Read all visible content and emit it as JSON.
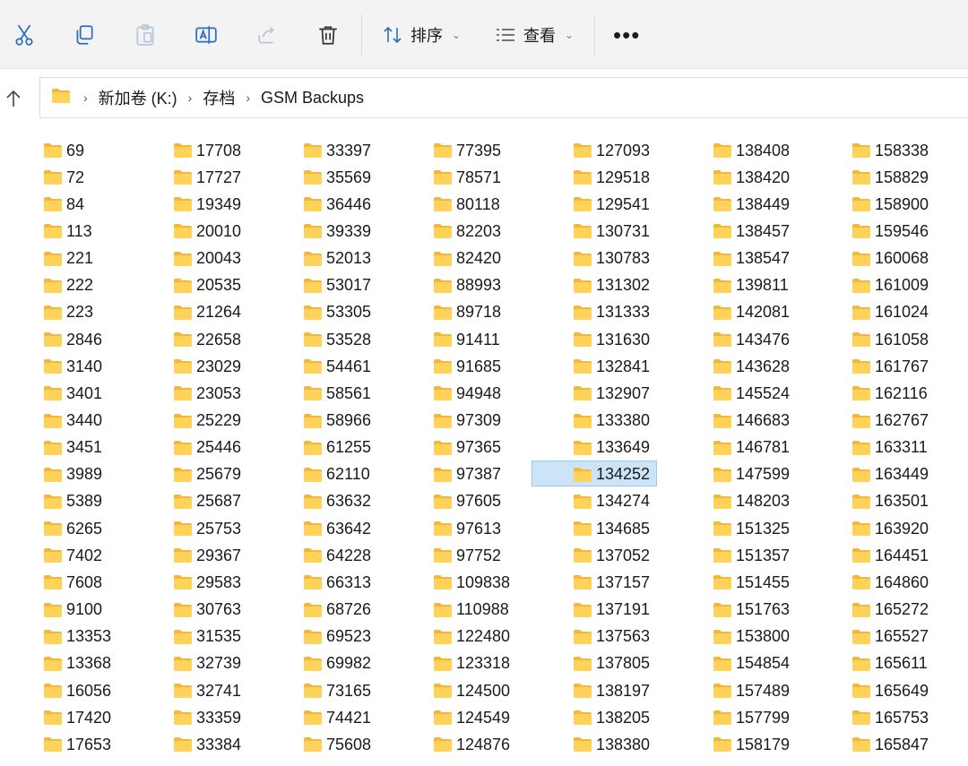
{
  "toolbar": {
    "sort_label": "排序",
    "view_label": "查看",
    "more_label": "•••"
  },
  "breadcrumb": [
    "新加卷 (K:)",
    "存档",
    "GSM Backups"
  ],
  "colors": {
    "folder_front": "#ffd35a",
    "folder_back": "#f3b73a",
    "selection_bg": "#cce4f7",
    "selection_border": "#99c9ef"
  },
  "selected_item": "134252",
  "columns": [
    [
      "69",
      "72",
      "84",
      "113",
      "221",
      "222",
      "223",
      "2846",
      "3140",
      "3401",
      "3440",
      "3451",
      "3989",
      "5389",
      "6265",
      "7402",
      "7608",
      "9100",
      "13353",
      "13368",
      "16056",
      "17420",
      "17653"
    ],
    [
      "17708",
      "17727",
      "19349",
      "20010",
      "20043",
      "20535",
      "21264",
      "22658",
      "23029",
      "23053",
      "25229",
      "25446",
      "25679",
      "25687",
      "25753",
      "29367",
      "29583",
      "30763",
      "31535",
      "32739",
      "32741",
      "33359",
      "33384"
    ],
    [
      "33397",
      "35569",
      "36446",
      "39339",
      "52013",
      "53017",
      "53305",
      "53528",
      "54461",
      "58561",
      "58966",
      "61255",
      "62110",
      "63632",
      "63642",
      "64228",
      "66313",
      "68726",
      "69523",
      "69982",
      "73165",
      "74421",
      "75608"
    ],
    [
      "77395",
      "78571",
      "80118",
      "82203",
      "82420",
      "88993",
      "89718",
      "91411",
      "91685",
      "94948",
      "97309",
      "97365",
      "97387",
      "97605",
      "97613",
      "97752",
      "109838",
      "110988",
      "122480",
      "123318",
      "124500",
      "124549",
      "124876"
    ],
    [
      "127093",
      "129518",
      "129541",
      "130731",
      "130783",
      "131302",
      "131333",
      "131630",
      "132841",
      "132907",
      "133380",
      "133649",
      "134252",
      "134274",
      "134685",
      "137052",
      "137157",
      "137191",
      "137563",
      "137805",
      "138197",
      "138205",
      "138380"
    ],
    [
      "138408",
      "138420",
      "138449",
      "138457",
      "138547",
      "139811",
      "142081",
      "143476",
      "143628",
      "145524",
      "146683",
      "146781",
      "147599",
      "148203",
      "151325",
      "151357",
      "151455",
      "151763",
      "153800",
      "154854",
      "157489",
      "157799",
      "158179"
    ],
    [
      "158338",
      "158829",
      "158900",
      "159546",
      "160068",
      "161009",
      "161024",
      "161058",
      "161767",
      "162116",
      "162767",
      "163311",
      "163449",
      "163501",
      "163920",
      "164451",
      "164860",
      "165272",
      "165527",
      "165611",
      "165649",
      "165753",
      "165847"
    ]
  ]
}
